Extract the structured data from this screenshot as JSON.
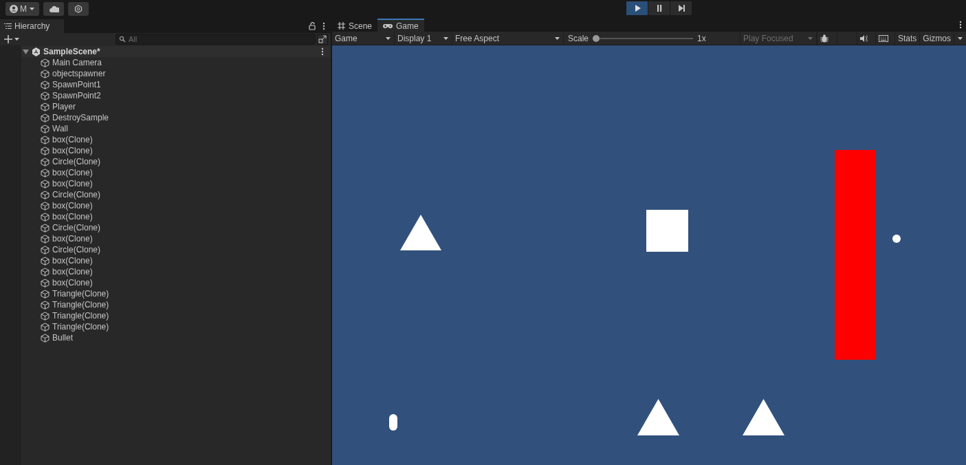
{
  "toolbar": {
    "account": "M",
    "play_buttons": [
      {
        "kind": "play",
        "selected": true
      },
      {
        "kind": "pause",
        "selected": false
      },
      {
        "kind": "step",
        "selected": false
      }
    ]
  },
  "hierarchy": {
    "tab": "Hierarchy",
    "search": {
      "placeholder": "All"
    },
    "scene": {
      "name": "SampleScene*",
      "expanded": true,
      "children": [
        {
          "name": "Main Camera"
        },
        {
          "name": "objectspawner"
        },
        {
          "name": "SpawnPoint1"
        },
        {
          "name": "SpawnPoint2"
        },
        {
          "name": "Player"
        },
        {
          "name": "DestroySample"
        },
        {
          "name": "Wall"
        },
        {
          "name": "box(Clone)"
        },
        {
          "name": "box(Clone)"
        },
        {
          "name": "Circle(Clone)"
        },
        {
          "name": "box(Clone)"
        },
        {
          "name": "box(Clone)"
        },
        {
          "name": "Circle(Clone)"
        },
        {
          "name": "box(Clone)"
        },
        {
          "name": "box(Clone)"
        },
        {
          "name": "Circle(Clone)"
        },
        {
          "name": "box(Clone)"
        },
        {
          "name": "Circle(Clone)"
        },
        {
          "name": "box(Clone)"
        },
        {
          "name": "box(Clone)"
        },
        {
          "name": "box(Clone)"
        },
        {
          "name": "Triangle(Clone)"
        },
        {
          "name": "Triangle(Clone)"
        },
        {
          "name": "Triangle(Clone)"
        },
        {
          "name": "Triangle(Clone)"
        },
        {
          "name": "Bullet"
        }
      ]
    }
  },
  "game_view": {
    "tabs": [
      {
        "kind": "scene",
        "label": "Scene",
        "selected": false
      },
      {
        "kind": "game",
        "label": "Game",
        "selected": true
      }
    ],
    "toolbar": {
      "view": "Game",
      "display": "Display 1",
      "aspect": "Free Aspect",
      "scale_label": "Scale",
      "scale": {
        "level": 0
      },
      "scale_value": "1x",
      "play_focus": "Play Focused",
      "stats": "Stats",
      "gizmos": "Gizmos"
    }
  }
}
